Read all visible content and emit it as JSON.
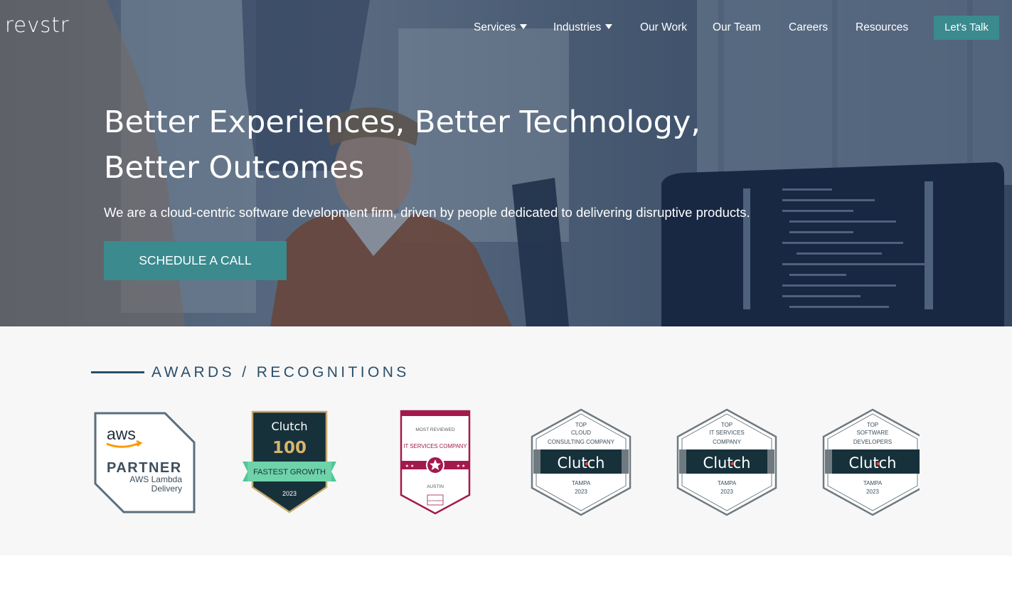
{
  "nav": {
    "logo": "revstr",
    "logo_star": "✧",
    "items": [
      "Services",
      "Industries",
      "Our Work",
      "Our Team",
      "Careers",
      "Resources"
    ],
    "cta": "Let's Talk"
  },
  "hero": {
    "headline_line1": "Better Experiences, Better Technology,",
    "headline_line2": "Better Outcomes",
    "subtitle": "We are a cloud-centric software development firm, driven by people dedicated to delivering disruptive products.",
    "button": "SCHEDULE A CALL"
  },
  "awards": {
    "title": "AWARDS / RECOGNITIONS",
    "aws": {
      "brand": "aws",
      "line1": "PARTNER",
      "line2": "AWS Lambda",
      "line3": "Delivery"
    },
    "clutch100": {
      "brand": "Clutch",
      "number": "100",
      "ribbon": "FASTEST GROWTH",
      "year": "2023"
    },
    "manifest": {
      "top": "MOST REVIEWED",
      "category": "IT SERVICES COMPANY",
      "city": "AUSTIN",
      "footer": "THE MANIFEST"
    },
    "clutch_badges": [
      {
        "top": "TOP",
        "line1": "CLOUD",
        "line2": "CONSULTING COMPANY",
        "brand": "Clutch",
        "city": "TAMPA",
        "year": "2023"
      },
      {
        "top": "TOP",
        "line1": "IT SERVICES",
        "line2": "COMPANY",
        "brand": "Clutch",
        "city": "TAMPA",
        "year": "2023"
      },
      {
        "top": "TOP",
        "line1": "SOFTWARE",
        "line2": "DEVELOPERS",
        "brand": "Clutch",
        "city": "TAMPA",
        "year": "2023"
      }
    ]
  },
  "colors": {
    "accent": "#3a8a8e",
    "navy": "#2b4f6a",
    "clutch_dark": "#17313b",
    "manifest_red": "#a3194d"
  }
}
